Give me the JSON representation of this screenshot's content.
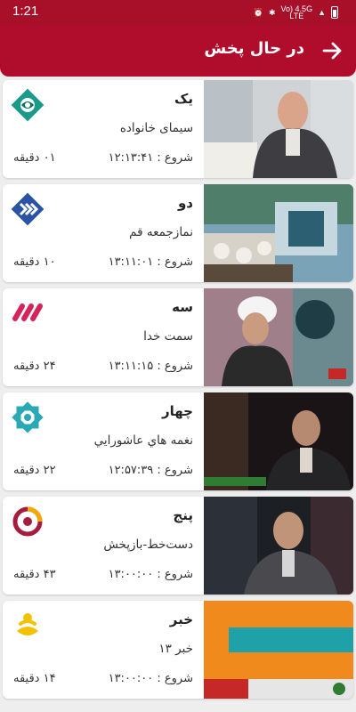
{
  "status": {
    "time": "1:21",
    "network_top": "Vo) 4.5G",
    "network_bottom": "LTE"
  },
  "header": {
    "title": "در حال پخش"
  },
  "channels": [
    {
      "name": "یک",
      "program": "سیمای خانواده",
      "start_label": "شروع : ۱۲:۱۳:۴۱",
      "duration": "۰۱ دقیقه",
      "logo": "channel-1-logo"
    },
    {
      "name": "دو",
      "program": "نمازجمعه قم",
      "start_label": "شروع : ۱۳:۱۱:۰۱",
      "duration": "۱۰ دقیقه",
      "logo": "channel-2-logo"
    },
    {
      "name": "سه",
      "program": "سمت خدا",
      "start_label": "شروع : ۱۳:۱۱:۱۵",
      "duration": "۲۴ دقیقه",
      "logo": "channel-3-logo"
    },
    {
      "name": "چهار",
      "program": "نغمه هاي عاشورايي",
      "start_label": "شروع : ۱۲:۵۷:۳۹",
      "duration": "۲۲ دقیقه",
      "logo": "channel-4-logo"
    },
    {
      "name": "پنج",
      "program": "دست‌خط-بازپخش",
      "start_label": "شروع : ۱۳:۰۰:۰۰",
      "duration": "۴۳ دقیقه",
      "logo": "channel-5-logo"
    },
    {
      "name": "خبر",
      "program": "خبر ۱۳",
      "start_label": "شروع : ۱۳:۰۰:۰۰",
      "duration": "۱۴ دقیقه",
      "logo": "khabar-logo"
    }
  ],
  "colors": {
    "header_bg": "#b00d2d",
    "status_bg": "#a8102a",
    "ch1": "#1a9b8a",
    "ch2": "#2a53a5",
    "ch3": "#d4245b",
    "ch4": "#2aa9b5",
    "ch5": "#a61c3c",
    "khabar": "#f2c200"
  }
}
